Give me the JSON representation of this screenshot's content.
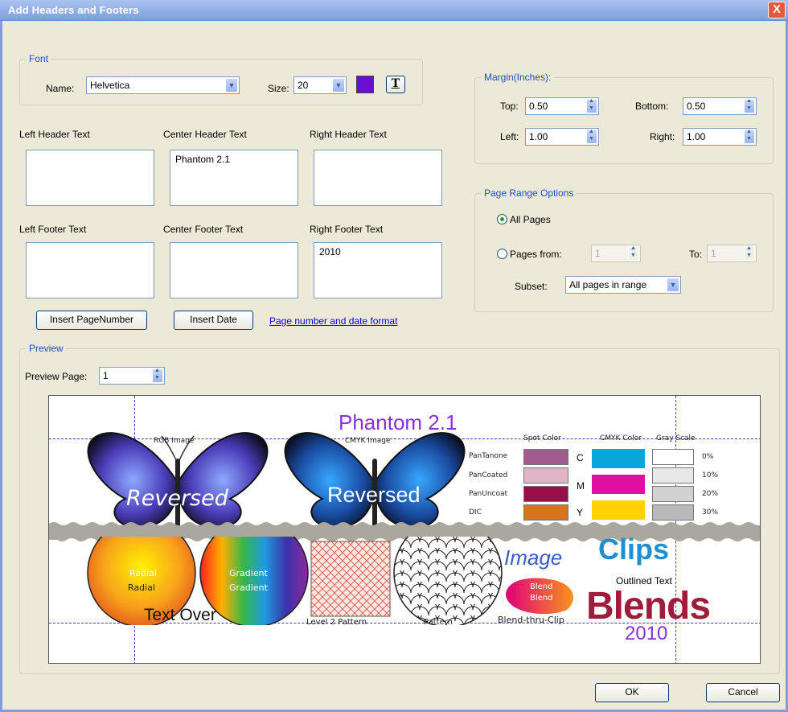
{
  "window": {
    "title": "Add Headers and Footers",
    "close_symbol": "X"
  },
  "font": {
    "legend": "Font",
    "name_label": "Name:",
    "name_value": "Helvetica",
    "size_label": "Size:",
    "size_value": "20",
    "color": "#6b0ecf",
    "underline_button": "T"
  },
  "header_texts": {
    "left_label": "Left Header Text",
    "left_value": "",
    "center_label": "Center Header Text",
    "center_value": "Phantom 2.1",
    "right_label": "Right Header Text",
    "right_value": ""
  },
  "footer_texts": {
    "left_label": "Left Footer Text",
    "left_value": "",
    "center_label": "Center Footer Text",
    "center_value": "",
    "right_label": "Right Footer Text",
    "right_value": "2010"
  },
  "buttons": {
    "insert_page_number": "Insert PageNumber",
    "insert_date": "Insert Date",
    "format_link": "Page number and date format",
    "ok": "OK",
    "cancel": "Cancel"
  },
  "margin": {
    "legend": "Margin(Inches):",
    "top_label": "Top:",
    "top_value": "0.50",
    "bottom_label": "Bottom:",
    "bottom_value": "0.50",
    "left_label": "Left:",
    "left_value": "1.00",
    "right_label": "Right:",
    "right_value": "1.00"
  },
  "page_range": {
    "legend": "Page Range Options",
    "all_pages": "All Pages",
    "pages_from": "Pages from:",
    "from_value": "1",
    "to_label": "To:",
    "to_value": "1",
    "subset_label": "Subset:",
    "subset_value": "All pages in range",
    "selected": "all"
  },
  "preview": {
    "legend": "Preview",
    "page_label": "Preview Page:",
    "page_value": "1",
    "header_text": "Phantom 2.1",
    "footer_text": "2010",
    "rgb_image": "RGB Image",
    "cmyk_image": "CMYK Image",
    "reversed": "Reversed",
    "spot_color": "Spot Color",
    "cmyk_color": "CMYK Color",
    "gray_scale": "Gray Scale",
    "spot_labels": [
      "PanTanone",
      "PanCoated",
      "PanUncoat",
      "DIC"
    ],
    "spot_colors": [
      "#a05c8c",
      "#e2b5c6",
      "#9c0e48",
      "#d9741e"
    ],
    "cmyk_letters": [
      "C",
      "M",
      "Y"
    ],
    "cmyk_colors": [
      "#0aa6d8",
      "#e00fa0",
      "#ffd200"
    ],
    "gray_labels": [
      "0%",
      "10%",
      "20%",
      "30%"
    ],
    "gray_colors": [
      "#ffffff",
      "#e8e8e8",
      "#d2d2d2",
      "#b9b9b9"
    ],
    "radial_top": "Radial",
    "radial": "Radial",
    "gradient_top": "Gradient",
    "gradient": "Gradient",
    "text_over": "Text Over",
    "level2_pattern": "Level 2 Pattern",
    "pattern": "Pattern",
    "image_word": "Image",
    "clips_word": "Clips",
    "outlined_text": "Outlined Text",
    "blend_top": "Blend",
    "blend": "Blend",
    "blend_thru_clip": "Blend-thru-Clip",
    "blends_word": "Blends"
  }
}
